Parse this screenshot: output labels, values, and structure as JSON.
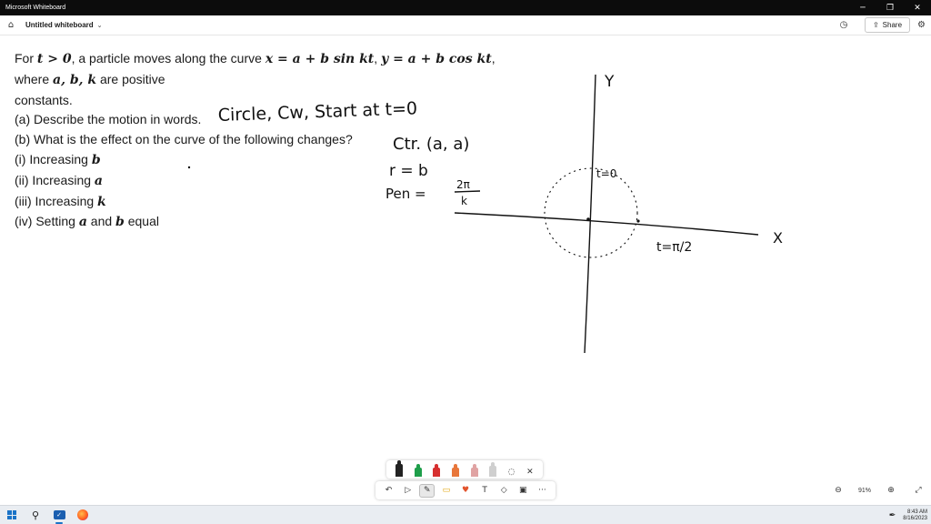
{
  "window": {
    "app_title": "Microsoft Whiteboard",
    "minimize": "─",
    "maximize": "❐",
    "close": "✕"
  },
  "appbar": {
    "board_title": "Untitled whiteboard",
    "share_label": "Share"
  },
  "problem": {
    "line1": {
      "pre": "For ",
      "m1": "t > 0",
      "mid": ", a particle moves along the curve ",
      "m2": "x = a + b sin kt",
      "sep": ", ",
      "m3": "y = a + b cos kt",
      "end": ","
    },
    "line2": {
      "pre": "where ",
      "m1": "a, b, k",
      "end": " are positive"
    },
    "line3": "constants.",
    "line4": "(a) Describe the motion in words.",
    "line5": "(b) What is the effect on the curve of the following changes?",
    "line6": {
      "pre": "(i) Increasing ",
      "m": "b"
    },
    "line7": {
      "pre": "(ii) Increasing ",
      "m": "a"
    },
    "line8": {
      "pre": "(iii) Increasing ",
      "m": "k"
    },
    "line9": {
      "pre": "(iv) Setting ",
      "m1": "a",
      "mid": " and ",
      "m2": "b",
      "end": " equal"
    }
  },
  "ink": {
    "answer_line": "Circle, Cw, Start at t=0",
    "center": "Ctr. (a, a)",
    "radius": "r = b",
    "period_label": "Pen =",
    "period_num": "2π",
    "period_den": "k",
    "y_axis": "Y",
    "x_axis": "X",
    "t0_label": "t=0",
    "t_pi2_label": "t=π/2"
  },
  "pen_tray": {
    "colors": [
      "#222222",
      "#1e9e4a",
      "#d62f2f",
      "#e8763a",
      "#e0a3a3",
      "#cfcfcf"
    ]
  },
  "toolbar": {
    "undo": "↶",
    "select": "▷",
    "pen": "✎",
    "note": "▭",
    "reactions": "♥",
    "text": "T",
    "shapes": "◇",
    "templates": "▣",
    "more": "···"
  },
  "zoom": {
    "zoom_out": "⊖",
    "level": "91%",
    "zoom_in": "⊕",
    "fit": "⤢"
  },
  "taskbar": {
    "time": "8:43 AM",
    "date": "8/16/2023"
  },
  "colors": {
    "titlebar": "#0c0c0c",
    "taskbar": "#e9edf2",
    "accent": "#1a73c7"
  }
}
